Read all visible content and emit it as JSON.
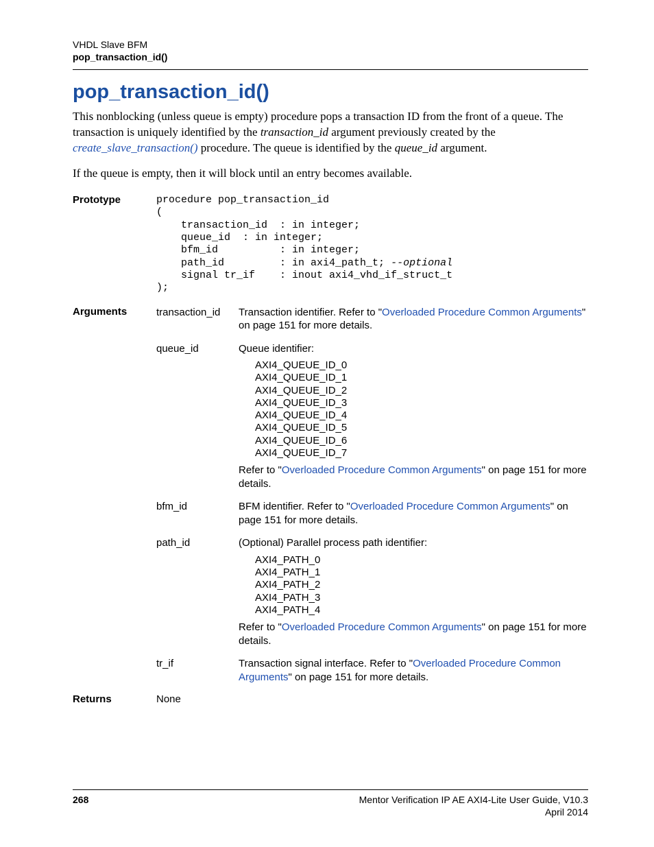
{
  "header": {
    "chapter": "VHDL Slave BFM",
    "topic": "pop_transaction_id()"
  },
  "title": "pop_transaction_id()",
  "paragraphs": {
    "p1_a": "This nonblocking (unless queue is empty) procedure pops a transaction ID from the front of a queue. The transaction is uniquely identified by the ",
    "p1_i1": "transaction_id",
    "p1_b": " argument previously created by the ",
    "p1_link": "create_slave_transaction()",
    "p1_c": " procedure. The queue is identified by the ",
    "p1_i2": "queue_id",
    "p1_d": " argument.",
    "p2": "If the queue is empty, then it will block until an entry becomes available."
  },
  "labels": {
    "prototype": "Prototype",
    "arguments": "Arguments",
    "returns": "Returns"
  },
  "prototype": {
    "l1": "procedure pop_transaction_id",
    "l2": "(",
    "l3": "    transaction_id  : in integer;",
    "l4": "    queue_id  : in integer;",
    "l5": "    bfm_id          : in integer;",
    "l6a": "    path_id         : in axi4_path_t; ",
    "l6b": "--optional",
    "l7": "    signal tr_if    : inout axi4_vhd_if_struct_t",
    "l8": ");"
  },
  "args": {
    "transaction_id": {
      "name": "transaction_id",
      "text_a": "Transaction identifier. Refer to \"",
      "link": "Overloaded Procedure Common Arguments",
      "text_b": "\" on page 151 for more details."
    },
    "queue_id": {
      "name": "queue_id",
      "intro": "Queue identifier:",
      "enum": [
        "AXI4_QUEUE_ID_0",
        "AXI4_QUEUE_ID_1",
        "AXI4_QUEUE_ID_2",
        "AXI4_QUEUE_ID_3",
        "AXI4_QUEUE_ID_4",
        "AXI4_QUEUE_ID_5",
        "AXI4_QUEUE_ID_6",
        "AXI4_QUEUE_ID_7"
      ],
      "ref_a": "Refer to \"",
      "ref_link": "Overloaded Procedure Common Arguments",
      "ref_b": "\" on page 151 for more details."
    },
    "bfm_id": {
      "name": "bfm_id",
      "text_a": "BFM identifier. Refer to \"",
      "link": "Overloaded Procedure Common Arguments",
      "text_b": "\" on page 151 for more details."
    },
    "path_id": {
      "name": "path_id",
      "intro": "(Optional) Parallel process path identifier:",
      "enum": [
        "AXI4_PATH_0",
        "AXI4_PATH_1",
        "AXI4_PATH_2",
        "AXI4_PATH_3",
        "AXI4_PATH_4"
      ],
      "ref_a": "Refer to \"",
      "ref_link": "Overloaded Procedure Common Arguments",
      "ref_b": "\" on page 151 for more details."
    },
    "tr_if": {
      "name": "tr_if",
      "text_a": "Transaction signal interface. Refer to \"",
      "link": "Overloaded Procedure Common Arguments",
      "text_b": "\" on page 151 for more details."
    }
  },
  "returns": "None",
  "footer": {
    "page": "268",
    "doc": "Mentor Verification IP AE AXI4-Lite User Guide, V10.3",
    "date": "April 2014"
  }
}
